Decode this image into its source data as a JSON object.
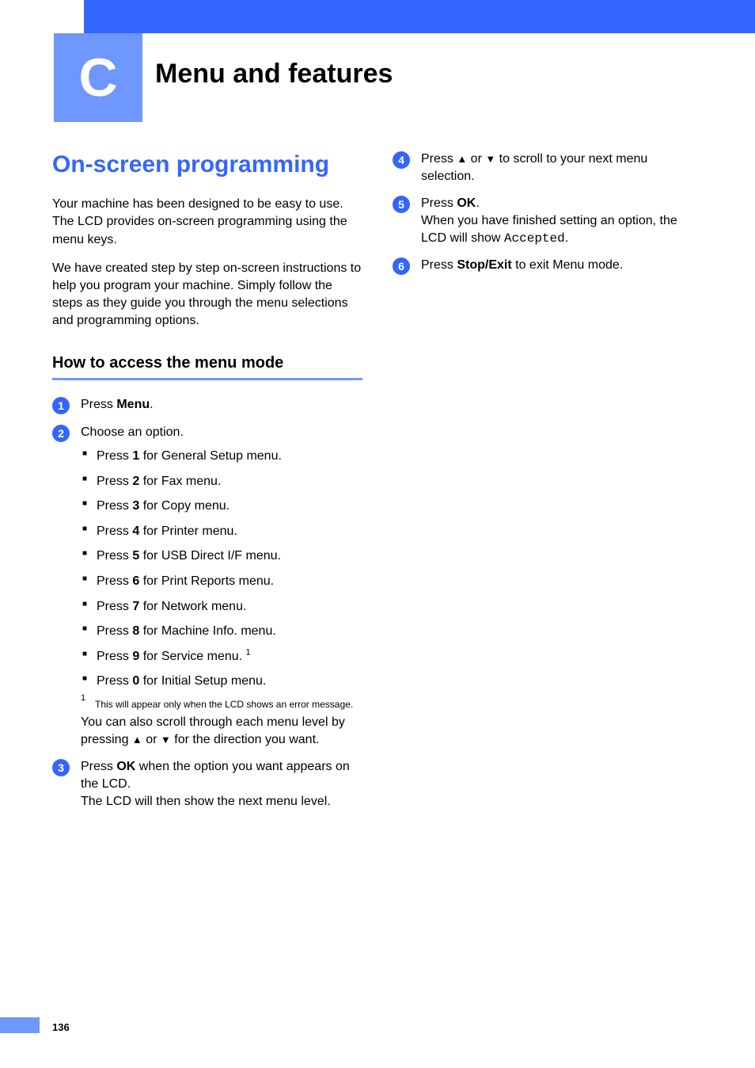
{
  "appendix": {
    "letter": "C",
    "title": "Menu and features"
  },
  "section": {
    "heading": "On-screen programming",
    "intro_p1": "Your machine has been designed to be easy to use. The LCD provides on-screen programming using the menu keys.",
    "intro_p2": "We have created step by step on-screen instructions to help you program your machine. Simply follow the steps as they guide you through the menu selections and programming options."
  },
  "subsection": {
    "heading": "How to access the menu mode"
  },
  "steps": {
    "s1": {
      "num": "1",
      "pre": "Press ",
      "key": "Menu",
      "post": "."
    },
    "s2": {
      "num": "2",
      "lead": "Choose an option.",
      "items": [
        {
          "pre": "Press ",
          "key": "1",
          "post": " for General Setup menu."
        },
        {
          "pre": "Press ",
          "key": "2",
          "post": " for Fax menu."
        },
        {
          "pre": "Press ",
          "key": "3",
          "post": " for Copy menu."
        },
        {
          "pre": "Press ",
          "key": "4",
          "post": " for Printer menu."
        },
        {
          "pre": "Press ",
          "key": "5",
          "post": " for USB Direct I/F menu."
        },
        {
          "pre": "Press ",
          "key": "6",
          "post": " for Print Reports menu."
        },
        {
          "pre": "Press ",
          "key": "7",
          "post": " for Network menu."
        },
        {
          "pre": "Press ",
          "key": "8",
          "post": " for Machine Info. menu."
        },
        {
          "pre": "Press ",
          "key": "9",
          "post": " for Service menu. ",
          "sup": "1"
        },
        {
          "pre": "Press ",
          "key": "0",
          "post": " for Initial Setup menu."
        }
      ],
      "footnote": {
        "mark": "1",
        "text": "This will appear only when the LCD shows an error message."
      },
      "tail_a": "You can also scroll through each menu level by pressing ",
      "tail_b": " or ",
      "tail_c": " for the direction you want."
    },
    "s3": {
      "num": "3",
      "a": "Press ",
      "key": "OK",
      "b": " when the option you want appears on the LCD.",
      "c": "The LCD will then show the next menu level."
    },
    "s4": {
      "num": "4",
      "a": "Press ",
      "b": " or ",
      "c": " to scroll to your next menu selection."
    },
    "s5": {
      "num": "5",
      "a": "Press ",
      "key": "OK",
      "b": ".",
      "c": "When you have finished setting an option, the LCD will show ",
      "mono": "Accepted",
      "d": "."
    },
    "s6": {
      "num": "6",
      "a": "Press ",
      "key": "Stop/Exit",
      "b": " to exit Menu mode."
    }
  },
  "glyphs": {
    "up": "▲",
    "down": "▼"
  },
  "page": {
    "number": "136"
  }
}
